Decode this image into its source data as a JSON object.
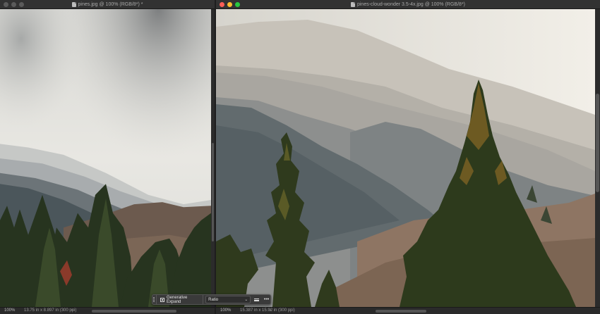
{
  "windows": {
    "left": {
      "title": "pines.jpg @ 100% (RGB/8*) *",
      "zoom": "100%",
      "doc_info": "13.75 in x 8.897 in (300 ppi)",
      "caret": "›"
    },
    "right": {
      "title": "pines-cloud-wonder 3.5-4x.jpg @ 100% (RGB/8*)",
      "zoom": "100%",
      "doc_info": "15.387 in x 15.92 in (300 ppi)",
      "caret": "›"
    }
  },
  "contextual_taskbar": {
    "generative_expand_label": "Generative Expand",
    "ratio_value": "Ratio",
    "more_label": "•••"
  },
  "icons": [
    "traffic-lights",
    "document-icon",
    "grip-icon",
    "generative-expand-icon",
    "chevron-down-icon",
    "bars-icon",
    "more-icon"
  ],
  "colors": {
    "close": "#ff5f57",
    "minimize": "#febc2e",
    "zoom": "#28c840",
    "chrome": "#323232"
  }
}
